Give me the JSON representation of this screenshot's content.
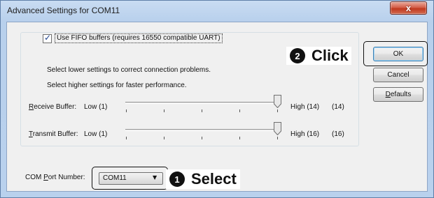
{
  "window": {
    "title": "Advanced Settings for COM11",
    "close_glyph": "x"
  },
  "fifo": {
    "checked": true,
    "label": "Use FIFO buffers (requires 16550 compatible UART)"
  },
  "info": {
    "line1": "Select lower settings to correct connection problems.",
    "line2": "Select higher settings for faster performance."
  },
  "receive": {
    "label_key": "R",
    "label_rest": "eceive Buffer:",
    "low": "Low (1)",
    "high": "High (14)",
    "value": "(14)",
    "level": 1.0
  },
  "transmit": {
    "label_key": "T",
    "label_rest": "ransmit Buffer:",
    "low": "Low (1)",
    "high": "High (16)",
    "value": "(16)",
    "level": 1.0
  },
  "buttons": {
    "ok": "OK",
    "cancel": "Cancel",
    "defaults_key": "D",
    "defaults_rest": "efaults"
  },
  "com_port": {
    "label_pre": "COM ",
    "label_key": "P",
    "label_rest": "ort Number:",
    "selected": "COM11",
    "arrow": "▼"
  },
  "callouts": {
    "click_step": "2",
    "click_text": "Click",
    "select_step": "1",
    "select_text": "Select"
  },
  "colors": {
    "title_bar": "#b9d1ed",
    "dialog_bg": "#f0f0f0",
    "close_button": "#c0391f",
    "ok_focus_border": "#3c7fb1",
    "callout_text": "#111111"
  }
}
